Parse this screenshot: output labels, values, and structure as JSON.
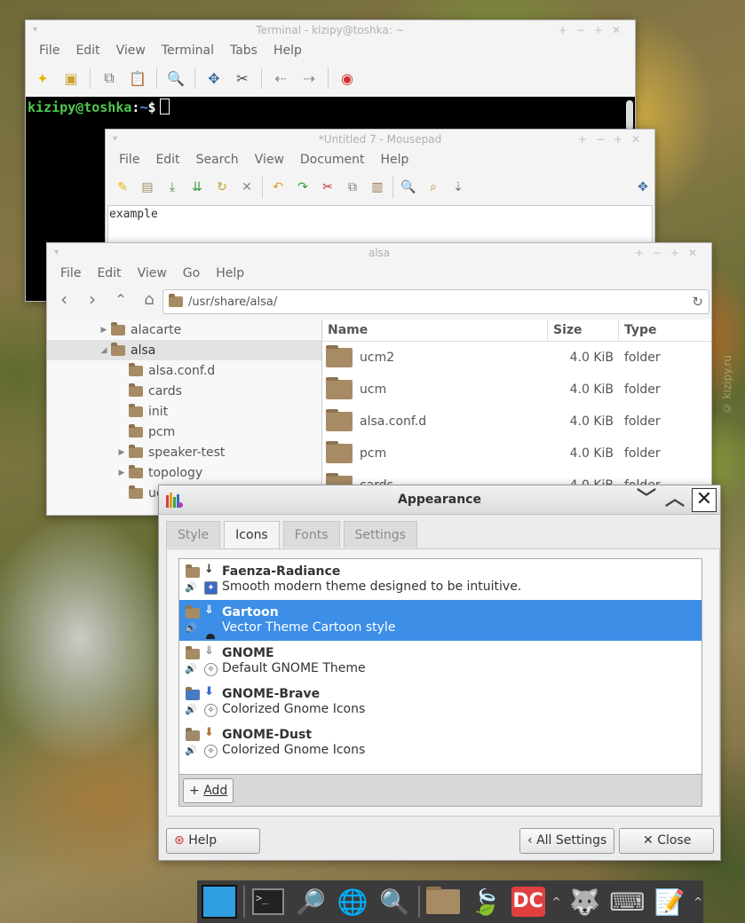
{
  "terminal": {
    "title": "Terminal - kizipy@toshka: ~",
    "menu": [
      "File",
      "Edit",
      "View",
      "Terminal",
      "Tabs",
      "Help"
    ],
    "prompt_user": "kizipy@toshka",
    "prompt_sep": ":",
    "prompt_dir": "~",
    "prompt_end": "$"
  },
  "mousepad": {
    "title": "*Untitled 7 - Mousepad",
    "menu": [
      "File",
      "Edit",
      "Search",
      "View",
      "Document",
      "Help"
    ],
    "content": "example"
  },
  "filemanager": {
    "title": "alsa",
    "menu": [
      "File",
      "Edit",
      "View",
      "Go",
      "Help"
    ],
    "path": "/usr/share/alsa/",
    "tree": [
      {
        "label": "alacarte",
        "expander": "▶"
      },
      {
        "label": "alsa",
        "expander": "◢"
      },
      {
        "label": "alsa.conf.d",
        "expander": ""
      },
      {
        "label": "cards",
        "expander": ""
      },
      {
        "label": "init",
        "expander": ""
      },
      {
        "label": "pcm",
        "expander": ""
      },
      {
        "label": "speaker-test",
        "expander": "▶"
      },
      {
        "label": "topology",
        "expander": "▶"
      },
      {
        "label": "ucm",
        "expander": ""
      }
    ],
    "columns": {
      "name": "Name",
      "size": "Size",
      "type": "Type"
    },
    "files": [
      {
        "name": "ucm2",
        "size": "4.0  KiB",
        "type": "folder"
      },
      {
        "name": "ucm",
        "size": "4.0  KiB",
        "type": "folder"
      },
      {
        "name": "alsa.conf.d",
        "size": "4.0  KiB",
        "type": "folder"
      },
      {
        "name": "pcm",
        "size": "4.0  KiB",
        "type": "folder"
      },
      {
        "name": "cards",
        "size": "4.0  KiB",
        "type": "folder"
      }
    ]
  },
  "appearance": {
    "title": "Appearance",
    "tabs": [
      "Style",
      "Icons",
      "Fonts",
      "Settings"
    ],
    "active_tab": "Icons",
    "themes": [
      {
        "name": "Faenza-Radiance",
        "desc": "Smooth modern theme designed to be intuitive."
      },
      {
        "name": "Gartoon",
        "desc": "Vector Theme Cartoon style"
      },
      {
        "name": "GNOME",
        "desc": "Default GNOME Theme"
      },
      {
        "name": "GNOME-Brave",
        "desc": "Colorized Gnome Icons"
      },
      {
        "name": "GNOME-Dust",
        "desc": "Colorized Gnome Icons"
      }
    ],
    "selected_theme": "Gartoon",
    "add_label": "Add",
    "help_label": "Help",
    "all_settings_label": "All Settings",
    "close_label": "Close",
    "selection_color": "#3c8ee6"
  },
  "dock": {
    "items": [
      "workspace-icon",
      "terminal-icon",
      "file-search-icon",
      "network-globe-icon",
      "search-icon",
      "folder-icon",
      "leaf-icon",
      "double-commander-icon",
      "gimp-icon",
      "keyboard-icon",
      "text-editor-icon"
    ]
  },
  "watermark": "© kizipy.ru"
}
